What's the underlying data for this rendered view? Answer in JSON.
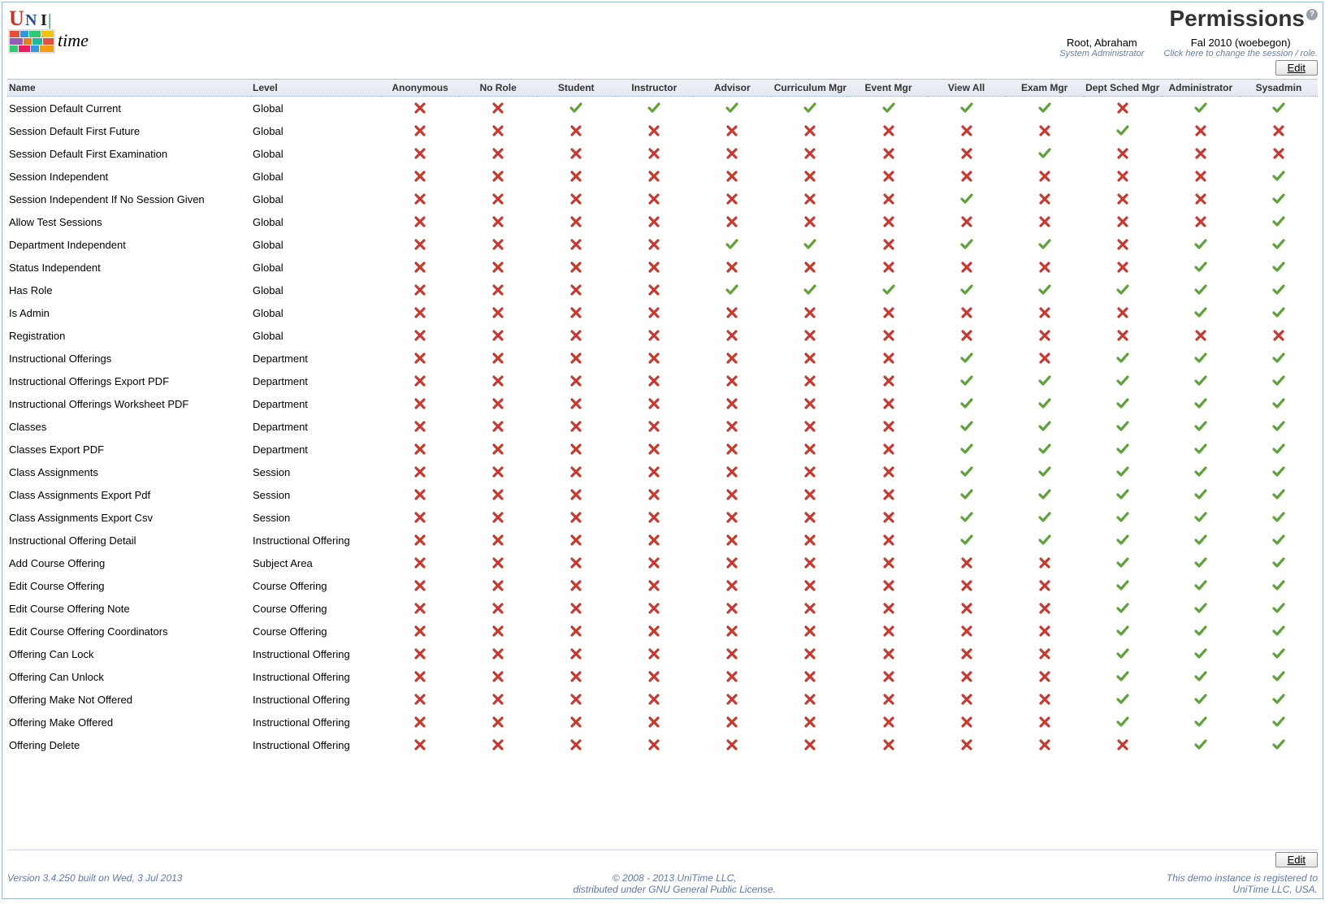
{
  "page_title": "Permissions",
  "user": {
    "name": "Root, Abraham",
    "role": "System Administrator"
  },
  "session": {
    "name": "Fal 2010 (woebegon)",
    "hint": "Click here to change the session / role."
  },
  "edit_label": "Edit",
  "columns": {
    "name": "Name",
    "level": "Level",
    "roles": [
      "Anonymous",
      "No Role",
      "Student",
      "Instructor",
      "Advisor",
      "Curriculum Mgr",
      "Event Mgr",
      "View All",
      "Exam Mgr",
      "Dept Sched Mgr",
      "Administrator",
      "Sysadmin"
    ]
  },
  "rows": [
    {
      "name": "Session Default Current",
      "level": "Global",
      "v": [
        0,
        0,
        1,
        1,
        1,
        1,
        1,
        1,
        1,
        0,
        1,
        1
      ]
    },
    {
      "name": "Session Default First Future",
      "level": "Global",
      "v": [
        0,
        0,
        0,
        0,
        0,
        0,
        0,
        0,
        0,
        1,
        0,
        0
      ]
    },
    {
      "name": "Session Default First Examination",
      "level": "Global",
      "v": [
        0,
        0,
        0,
        0,
        0,
        0,
        0,
        0,
        1,
        0,
        0,
        0
      ]
    },
    {
      "name": "Session Independent",
      "level": "Global",
      "v": [
        0,
        0,
        0,
        0,
        0,
        0,
        0,
        0,
        0,
        0,
        0,
        1
      ]
    },
    {
      "name": "Session Independent If No Session Given",
      "level": "Global",
      "v": [
        0,
        0,
        0,
        0,
        0,
        0,
        0,
        1,
        0,
        0,
        0,
        1
      ]
    },
    {
      "name": "Allow Test Sessions",
      "level": "Global",
      "v": [
        0,
        0,
        0,
        0,
        0,
        0,
        0,
        0,
        0,
        0,
        0,
        1
      ]
    },
    {
      "name": "Department Independent",
      "level": "Global",
      "v": [
        0,
        0,
        0,
        0,
        1,
        1,
        0,
        1,
        1,
        0,
        1,
        1
      ]
    },
    {
      "name": "Status Independent",
      "level": "Global",
      "v": [
        0,
        0,
        0,
        0,
        0,
        0,
        0,
        0,
        0,
        0,
        1,
        1
      ]
    },
    {
      "name": "Has Role",
      "level": "Global",
      "v": [
        0,
        0,
        0,
        0,
        1,
        1,
        1,
        1,
        1,
        1,
        1,
        1
      ]
    },
    {
      "name": "Is Admin",
      "level": "Global",
      "v": [
        0,
        0,
        0,
        0,
        0,
        0,
        0,
        0,
        0,
        0,
        1,
        1
      ]
    },
    {
      "name": "Registration",
      "level": "Global",
      "v": [
        0,
        0,
        0,
        0,
        0,
        0,
        0,
        0,
        0,
        0,
        0,
        0
      ]
    },
    {
      "name": "Instructional Offerings",
      "level": "Department",
      "v": [
        0,
        0,
        0,
        0,
        0,
        0,
        0,
        1,
        0,
        1,
        1,
        1
      ]
    },
    {
      "name": "Instructional Offerings Export PDF",
      "level": "Department",
      "v": [
        0,
        0,
        0,
        0,
        0,
        0,
        0,
        1,
        1,
        1,
        1,
        1
      ]
    },
    {
      "name": "Instructional Offerings Worksheet PDF",
      "level": "Department",
      "v": [
        0,
        0,
        0,
        0,
        0,
        0,
        0,
        1,
        1,
        1,
        1,
        1
      ]
    },
    {
      "name": "Classes",
      "level": "Department",
      "v": [
        0,
        0,
        0,
        0,
        0,
        0,
        0,
        1,
        1,
        1,
        1,
        1
      ]
    },
    {
      "name": "Classes Export PDF",
      "level": "Department",
      "v": [
        0,
        0,
        0,
        0,
        0,
        0,
        0,
        1,
        1,
        1,
        1,
        1
      ]
    },
    {
      "name": "Class Assignments",
      "level": "Session",
      "v": [
        0,
        0,
        0,
        0,
        0,
        0,
        0,
        1,
        1,
        1,
        1,
        1
      ]
    },
    {
      "name": "Class Assignments Export Pdf",
      "level": "Session",
      "v": [
        0,
        0,
        0,
        0,
        0,
        0,
        0,
        1,
        1,
        1,
        1,
        1
      ]
    },
    {
      "name": "Class Assignments Export Csv",
      "level": "Session",
      "v": [
        0,
        0,
        0,
        0,
        0,
        0,
        0,
        1,
        1,
        1,
        1,
        1
      ]
    },
    {
      "name": "Instructional Offering Detail",
      "level": "Instructional Offering",
      "v": [
        0,
        0,
        0,
        0,
        0,
        0,
        0,
        1,
        1,
        1,
        1,
        1
      ]
    },
    {
      "name": "Add Course Offering",
      "level": "Subject Area",
      "v": [
        0,
        0,
        0,
        0,
        0,
        0,
        0,
        0,
        0,
        1,
        1,
        1
      ]
    },
    {
      "name": "Edit Course Offering",
      "level": "Course Offering",
      "v": [
        0,
        0,
        0,
        0,
        0,
        0,
        0,
        0,
        0,
        1,
        1,
        1
      ]
    },
    {
      "name": "Edit Course Offering Note",
      "level": "Course Offering",
      "v": [
        0,
        0,
        0,
        0,
        0,
        0,
        0,
        0,
        0,
        1,
        1,
        1
      ]
    },
    {
      "name": "Edit Course Offering Coordinators",
      "level": "Course Offering",
      "v": [
        0,
        0,
        0,
        0,
        0,
        0,
        0,
        0,
        0,
        1,
        1,
        1
      ]
    },
    {
      "name": "Offering Can Lock",
      "level": "Instructional Offering",
      "v": [
        0,
        0,
        0,
        0,
        0,
        0,
        0,
        0,
        0,
        1,
        1,
        1
      ]
    },
    {
      "name": "Offering Can Unlock",
      "level": "Instructional Offering",
      "v": [
        0,
        0,
        0,
        0,
        0,
        0,
        0,
        0,
        0,
        1,
        1,
        1
      ]
    },
    {
      "name": "Offering Make Not Offered",
      "level": "Instructional Offering",
      "v": [
        0,
        0,
        0,
        0,
        0,
        0,
        0,
        0,
        0,
        1,
        1,
        1
      ]
    },
    {
      "name": "Offering Make Offered",
      "level": "Instructional Offering",
      "v": [
        0,
        0,
        0,
        0,
        0,
        0,
        0,
        0,
        0,
        1,
        1,
        1
      ]
    },
    {
      "name": "Offering Delete",
      "level": "Instructional Offering",
      "v": [
        0,
        0,
        0,
        0,
        0,
        0,
        0,
        0,
        0,
        0,
        1,
        1
      ]
    }
  ],
  "footer": {
    "version": "Version 3.4.250 built on Wed, 3 Jul 2013",
    "copyright1": "© 2008 - 2013 UniTime LLC,",
    "copyright2": "distributed under GNU General Public License.",
    "registered1": "This demo instance is registered to",
    "registered2": "UniTime LLC, USA."
  }
}
